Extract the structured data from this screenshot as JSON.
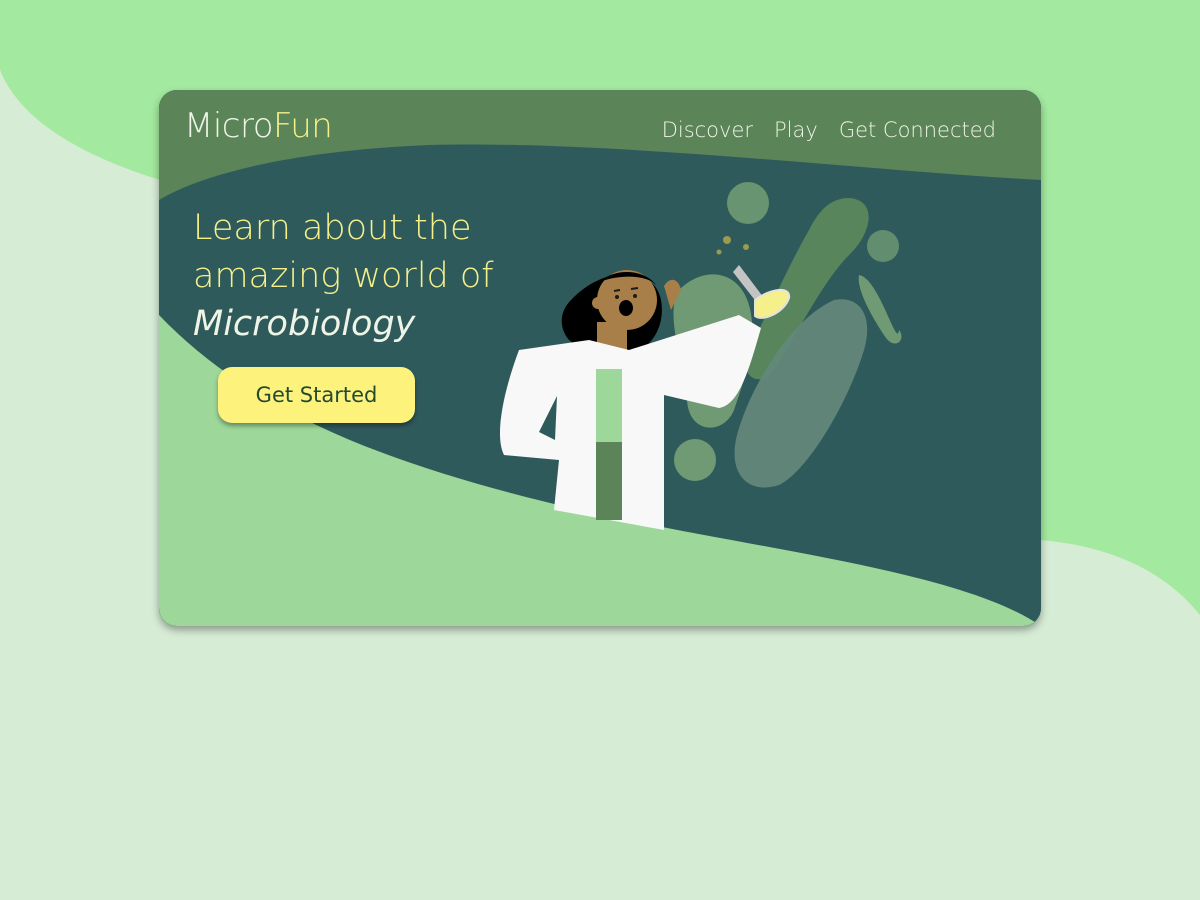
{
  "brand": {
    "part1": "Micro",
    "part2": "Fun"
  },
  "nav": {
    "items": [
      {
        "label": "Discover"
      },
      {
        "label": "Play"
      },
      {
        "label": "Get Connected"
      }
    ]
  },
  "hero": {
    "line1": "Learn about the",
    "line2": "amazing world of",
    "line3": "Microbiology",
    "cta_label": "Get Started"
  },
  "colors": {
    "page_bg": "#d6ecd5",
    "page_blob": "#a3e99f",
    "card_dark": "#2f5a5c",
    "card_header": "#5b8459",
    "card_wave": "#9dd799",
    "accent_yellow": "#f5f08a",
    "button_yellow": "#fdf27c"
  }
}
